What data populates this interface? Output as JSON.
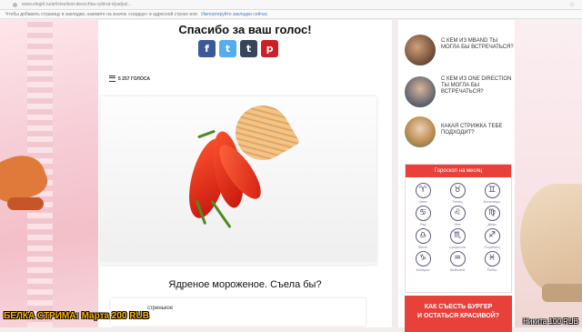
{
  "browser": {
    "url": "www.elegirl.ru/articles/test-devochka-vybirat-dyadya/...",
    "bookmark_hint": "Чтобы добавить страницу в закладки, нажмите на значок «сердце» в адресной строке или",
    "bookmark_link": "Импортируйте закладки сейчас"
  },
  "main": {
    "vote_title": "Спасибо за ваш голос!",
    "share": {
      "facebook": "f",
      "twitter": "t",
      "tumblr": "t",
      "pinterest": "p"
    },
    "votes_count": "5 257 ГОЛОСА",
    "caption": "Ядреное мороженое. Съела бы?",
    "answer_text": "стренькое"
  },
  "sidebar": {
    "recs": [
      {
        "title": "С кем из MBAND ты могла бы встречаться?"
      },
      {
        "title": "С кем из ONE DIRECTION ты могла бы встречаться?"
      },
      {
        "title": "Какая стрижка тебе подходит?"
      }
    ],
    "horoscope": {
      "title": "Гороскоп на месяц",
      "signs": [
        {
          "glyph": "♈",
          "name": "Овен"
        },
        {
          "glyph": "♉",
          "name": "Телец"
        },
        {
          "glyph": "♊",
          "name": "Близнецы"
        },
        {
          "glyph": "♋",
          "name": "Рак"
        },
        {
          "glyph": "♌",
          "name": "Лев"
        },
        {
          "glyph": "♍",
          "name": "Дева"
        },
        {
          "glyph": "♎",
          "name": "Весы"
        },
        {
          "glyph": "♏",
          "name": "Скорпион"
        },
        {
          "glyph": "♐",
          "name": "Стрелец"
        },
        {
          "glyph": "♑",
          "name": "Козерог"
        },
        {
          "glyph": "♒",
          "name": "Водолей"
        },
        {
          "glyph": "♓",
          "name": "Рыбы"
        }
      ]
    },
    "promo": {
      "line1": "КАК СЪЕСТЬ БУРГЕР",
      "line2": "И ОСТАТЬСЯ КРАСИВОЙ?"
    }
  },
  "overlay": {
    "banner": "БЕЛКА СТРИМА: Марта 200 RUB",
    "credit": "Никита 100 RUB"
  },
  "colors": {
    "accent": "#e8413a",
    "facebook": "#3b5998",
    "twitter": "#55acee",
    "tumblr": "#35465c",
    "pinterest": "#cb2027"
  }
}
